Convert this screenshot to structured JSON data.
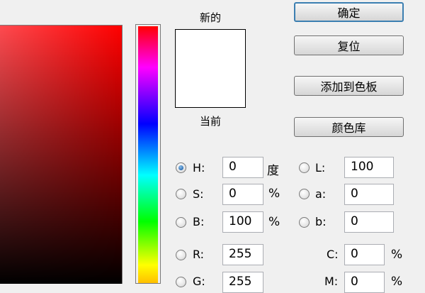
{
  "swatch": {
    "new_label": "新的",
    "current_label": "当前"
  },
  "buttons": {
    "ok": "确定",
    "reset": "复位",
    "add_to_swatches": "添加到色板",
    "color_libraries": "颜色库"
  },
  "fields": {
    "H": {
      "label": "H:",
      "value": "0",
      "unit": "度"
    },
    "S": {
      "label": "S:",
      "value": "0",
      "unit": "%"
    },
    "B": {
      "label": "B:",
      "value": "100",
      "unit": "%"
    },
    "R": {
      "label": "R:",
      "value": "255"
    },
    "G": {
      "label": "G:",
      "value": "255"
    },
    "L": {
      "label": "L:",
      "value": "100"
    },
    "a": {
      "label": "a:",
      "value": "0"
    },
    "b": {
      "label": "b:",
      "value": "0"
    },
    "C": {
      "label": "C:",
      "value": "0",
      "unit": "%"
    },
    "M": {
      "label": "M:",
      "value": "0",
      "unit": "%"
    }
  },
  "selected_mode": "H"
}
